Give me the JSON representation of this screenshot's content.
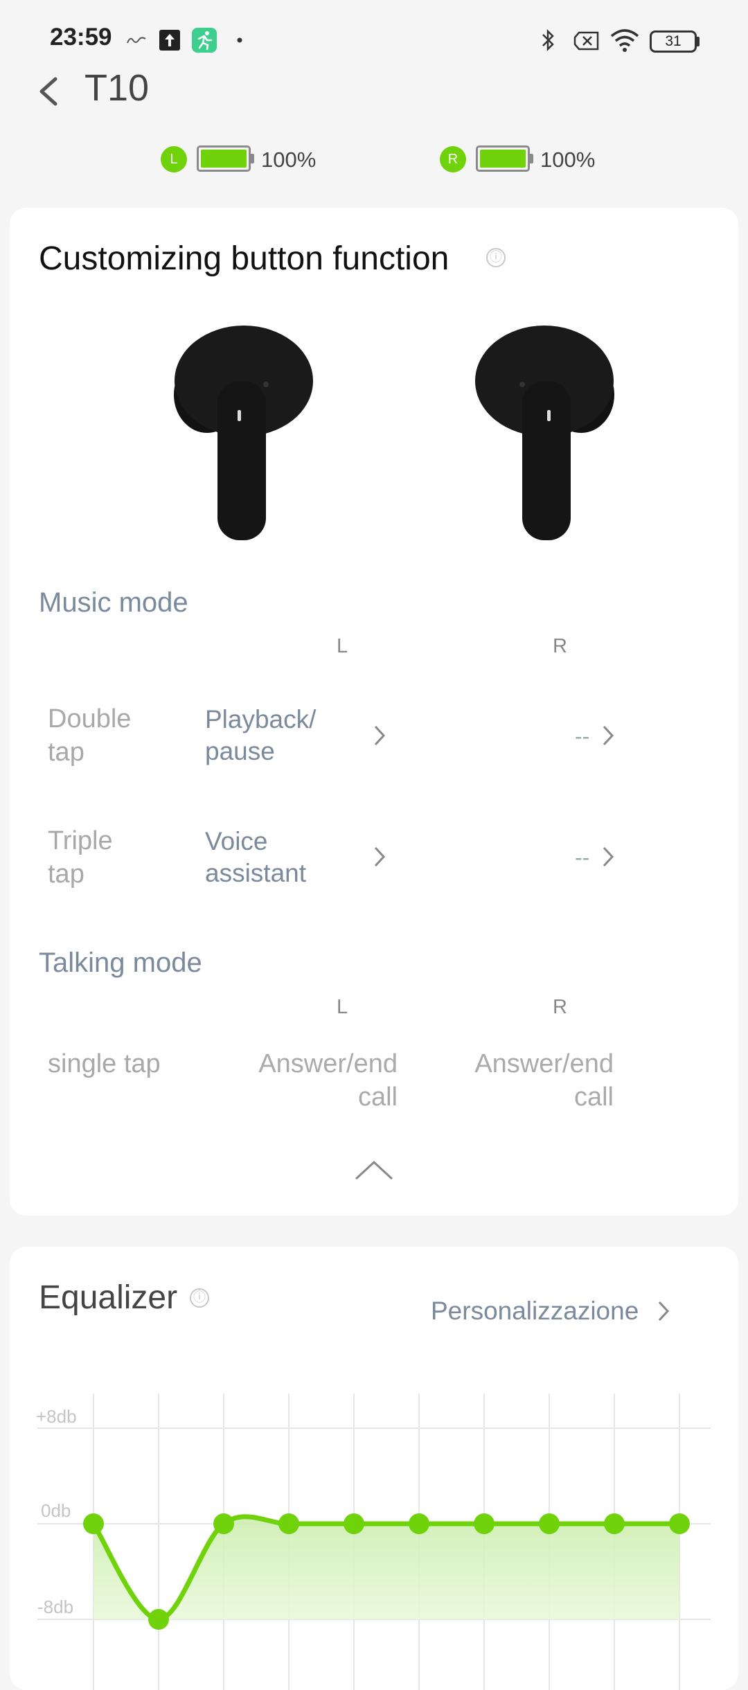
{
  "status_bar": {
    "time": "23:59",
    "battery_level": "31",
    "icons": [
      "netspeed-icon",
      "upload-icon",
      "fitness-app-icon",
      "notification-dot-icon",
      "bluetooth-icon",
      "no-sim-icon",
      "wifi-icon",
      "battery-icon"
    ]
  },
  "header": {
    "title": "T10",
    "back_icon": "chevron-left-icon"
  },
  "batteries": {
    "left": {
      "badge": "L",
      "percent_text": "100%",
      "level": 1.0
    },
    "right": {
      "badge": "R",
      "percent_text": "100%",
      "level": 1.0
    }
  },
  "button_card": {
    "title": "Customizing button function",
    "info_icon": "ⓘ",
    "music_mode": {
      "title": "Music mode",
      "col_left": "L",
      "col_right": "R",
      "rows": [
        {
          "label_line1": "Double",
          "label_line2": "tap",
          "left_line1": "Playback/",
          "left_line2": "pause",
          "right": "--"
        },
        {
          "label_line1": "Triple",
          "label_line2": "tap",
          "left_line1": "Voice",
          "left_line2": "assistant",
          "right": "--"
        }
      ]
    },
    "talking_mode": {
      "title": "Talking mode",
      "col_left": "L",
      "col_right": "R",
      "row": {
        "label": "single tap",
        "left_line1": "Answer/end",
        "left_line2": "call",
        "right_line1": "Answer/end",
        "right_line2": "call"
      }
    },
    "collapse_icon": "chevron-up-icon"
  },
  "equalizer": {
    "title": "Equalizer",
    "info_icon": "ⓘ",
    "preset_label": "Personalizzazione",
    "chart_data": {
      "type": "line",
      "y_labels": [
        "+8db",
        "0db",
        "-8db"
      ],
      "ylim": [
        -8,
        8
      ],
      "bands": 10,
      "values": [
        0,
        -8,
        0,
        0,
        0,
        0,
        0,
        0,
        0,
        0
      ],
      "color": "#6fd20a"
    }
  },
  "colors": {
    "accent": "#6fd20a",
    "section": "#7a8a9c"
  }
}
